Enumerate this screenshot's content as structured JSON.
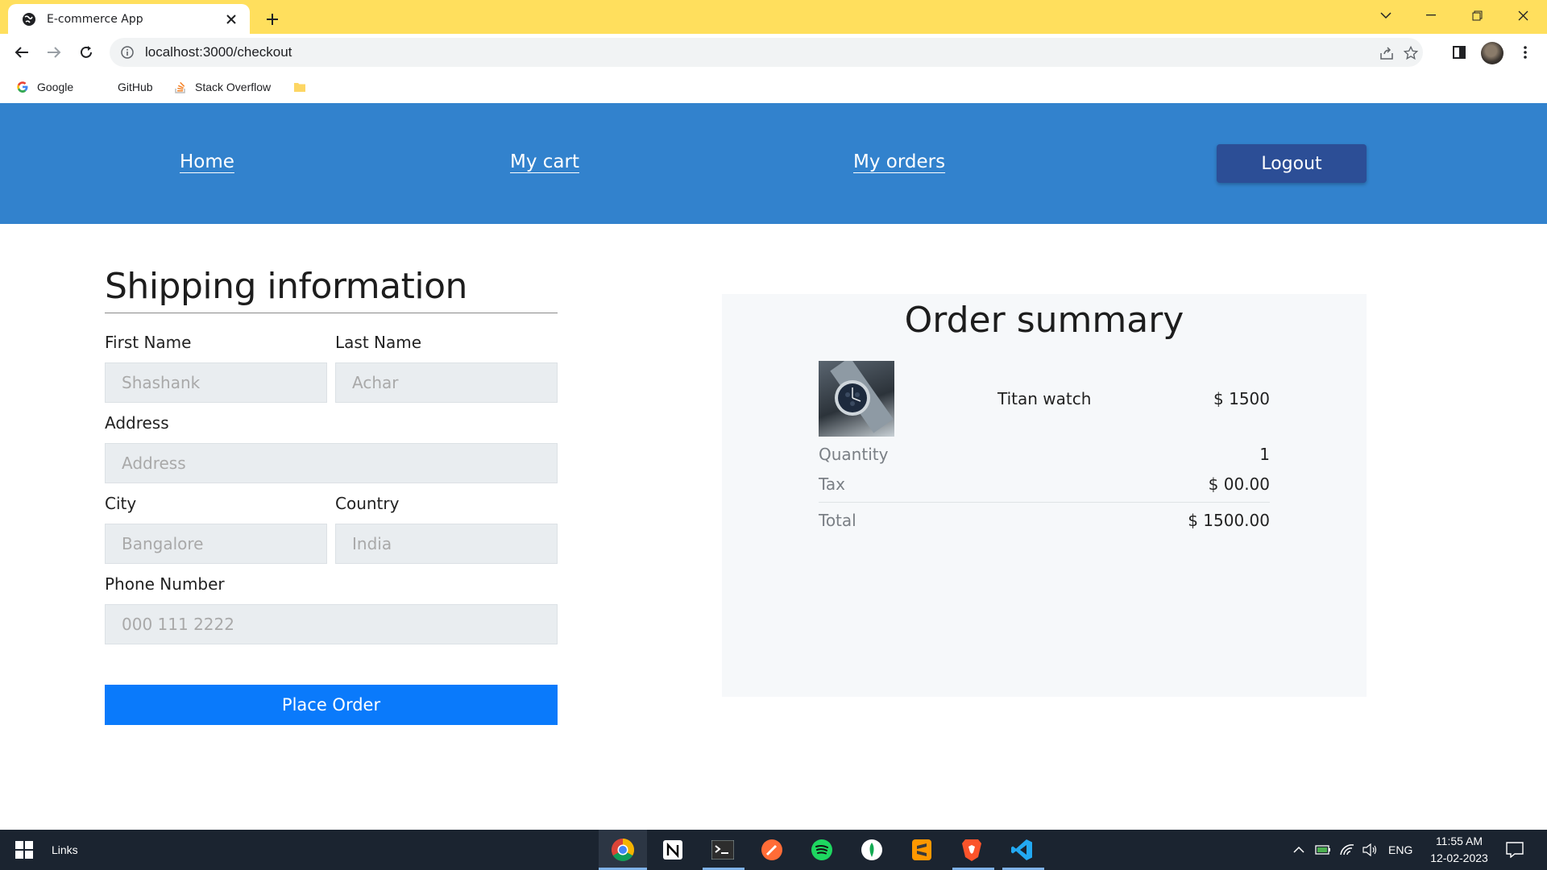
{
  "browser": {
    "tab_title": "E-commerce App",
    "url": "localhost:3000/checkout",
    "bookmarks": [
      {
        "label": "Google"
      },
      {
        "label": "GitHub"
      },
      {
        "label": "Stack Overflow"
      }
    ]
  },
  "nav": {
    "home": "Home",
    "cart": "My cart",
    "orders": "My orders",
    "logout": "Logout"
  },
  "shipping": {
    "title": "Shipping information",
    "first_name_label": "First Name",
    "first_name_placeholder": "Shashank",
    "last_name_label": "Last Name",
    "last_name_placeholder": "Achar",
    "address_label": "Address",
    "address_placeholder": "Address",
    "city_label": "City",
    "city_placeholder": "Bangalore",
    "country_label": "Country",
    "country_placeholder": "India",
    "phone_label": "Phone Number",
    "phone_placeholder": "000 111 2222",
    "submit": "Place Order"
  },
  "summary": {
    "title": "Order summary",
    "item_name": "Titan watch",
    "item_price": "$ 1500",
    "quantity_label": "Quantity",
    "quantity_value": "1",
    "tax_label": "Tax",
    "tax_value": "$ 00.00",
    "total_label": "Total",
    "total_value": "$ 1500.00"
  },
  "taskbar": {
    "links": "Links",
    "lang": "ENG",
    "time": "11:55 AM",
    "date": "12-02-2023"
  },
  "colors": {
    "tabstrip": "#ffdf5d",
    "nav_bg": "#3282cd",
    "logout_bg": "#2c4e96",
    "place_order_bg": "#0a7afb",
    "summary_bg": "#f6f8fa",
    "taskbar_bg": "#1b2430"
  }
}
